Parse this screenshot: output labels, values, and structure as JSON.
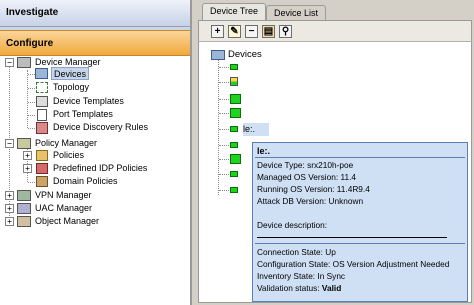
{
  "left_nav": {
    "investigate": "Investigate",
    "configure": "Configure",
    "tree": [
      {
        "label": "Device Manager"
      },
      {
        "label": "Devices"
      },
      {
        "label": "Topology"
      },
      {
        "label": "Device Templates"
      },
      {
        "label": "Port Templates"
      },
      {
        "label": "Device Discovery Rules"
      },
      {
        "label": "Policy Manager"
      },
      {
        "label": "Policies"
      },
      {
        "label": "Predefined IDP Policies"
      },
      {
        "label": "Domain Policies"
      },
      {
        "label": "VPN Manager"
      },
      {
        "label": "UAC Manager"
      },
      {
        "label": "Object Manager"
      }
    ]
  },
  "tabs": [
    {
      "label": "Device Tree"
    },
    {
      "label": "Device List"
    }
  ],
  "toolbar": {
    "icons": [
      "add-icon",
      "edit-icon",
      "remove-icon",
      "import-icon",
      "search-icon"
    ]
  },
  "device_tree": {
    "root": "Devices",
    "selected_partial": "le:."
  },
  "tooltip": {
    "title": "le:.",
    "device_type": "Device Type: srx210h-poe",
    "managed_os": "Managed OS Version: 11.4",
    "running_os": "Running OS Version: 11.4R9.4",
    "attack_db": "Attack DB Version: Unknown",
    "description_label": "Device description:",
    "connection_state": "Connection State: Up",
    "configuration_state": "Configuration State: OS Version Adjustment Needed",
    "inventory_state": "Inventory State: In Sync",
    "validation_label": "Validation status: ",
    "validation_value": "Valid"
  },
  "colors": {
    "configure_bg": "#f0a93d",
    "device_up": "#1ed31e",
    "tooltip_bg": "#cfe0f5"
  }
}
